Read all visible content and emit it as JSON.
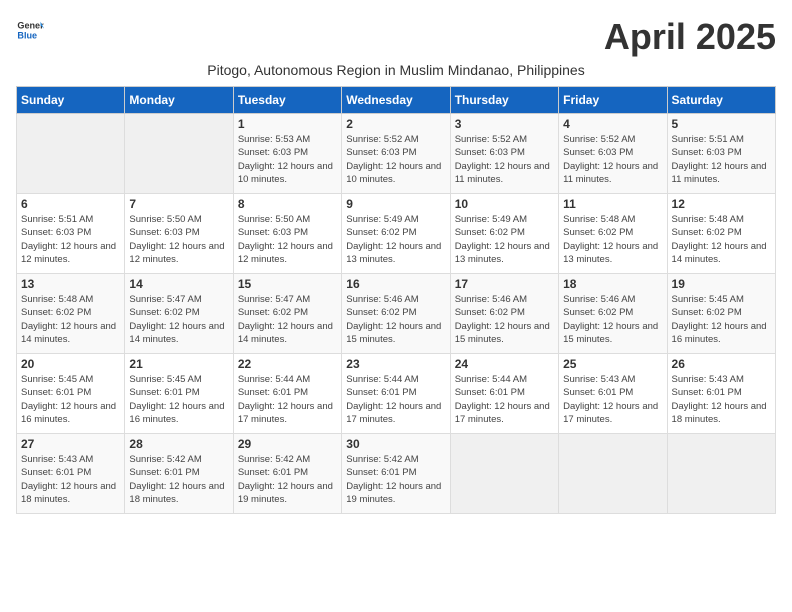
{
  "logo": {
    "general": "General",
    "blue": "Blue"
  },
  "title": "April 2025",
  "subtitle": "Pitogo, Autonomous Region in Muslim Mindanao, Philippines",
  "weekdays": [
    "Sunday",
    "Monday",
    "Tuesday",
    "Wednesday",
    "Thursday",
    "Friday",
    "Saturday"
  ],
  "weeks": [
    [
      {
        "day": "",
        "info": ""
      },
      {
        "day": "",
        "info": ""
      },
      {
        "day": "1",
        "info": "Sunrise: 5:53 AM\nSunset: 6:03 PM\nDaylight: 12 hours and 10 minutes."
      },
      {
        "day": "2",
        "info": "Sunrise: 5:52 AM\nSunset: 6:03 PM\nDaylight: 12 hours and 10 minutes."
      },
      {
        "day": "3",
        "info": "Sunrise: 5:52 AM\nSunset: 6:03 PM\nDaylight: 12 hours and 11 minutes."
      },
      {
        "day": "4",
        "info": "Sunrise: 5:52 AM\nSunset: 6:03 PM\nDaylight: 12 hours and 11 minutes."
      },
      {
        "day": "5",
        "info": "Sunrise: 5:51 AM\nSunset: 6:03 PM\nDaylight: 12 hours and 11 minutes."
      }
    ],
    [
      {
        "day": "6",
        "info": "Sunrise: 5:51 AM\nSunset: 6:03 PM\nDaylight: 12 hours and 12 minutes."
      },
      {
        "day": "7",
        "info": "Sunrise: 5:50 AM\nSunset: 6:03 PM\nDaylight: 12 hours and 12 minutes."
      },
      {
        "day": "8",
        "info": "Sunrise: 5:50 AM\nSunset: 6:03 PM\nDaylight: 12 hours and 12 minutes."
      },
      {
        "day": "9",
        "info": "Sunrise: 5:49 AM\nSunset: 6:02 PM\nDaylight: 12 hours and 13 minutes."
      },
      {
        "day": "10",
        "info": "Sunrise: 5:49 AM\nSunset: 6:02 PM\nDaylight: 12 hours and 13 minutes."
      },
      {
        "day": "11",
        "info": "Sunrise: 5:48 AM\nSunset: 6:02 PM\nDaylight: 12 hours and 13 minutes."
      },
      {
        "day": "12",
        "info": "Sunrise: 5:48 AM\nSunset: 6:02 PM\nDaylight: 12 hours and 14 minutes."
      }
    ],
    [
      {
        "day": "13",
        "info": "Sunrise: 5:48 AM\nSunset: 6:02 PM\nDaylight: 12 hours and 14 minutes."
      },
      {
        "day": "14",
        "info": "Sunrise: 5:47 AM\nSunset: 6:02 PM\nDaylight: 12 hours and 14 minutes."
      },
      {
        "day": "15",
        "info": "Sunrise: 5:47 AM\nSunset: 6:02 PM\nDaylight: 12 hours and 14 minutes."
      },
      {
        "day": "16",
        "info": "Sunrise: 5:46 AM\nSunset: 6:02 PM\nDaylight: 12 hours and 15 minutes."
      },
      {
        "day": "17",
        "info": "Sunrise: 5:46 AM\nSunset: 6:02 PM\nDaylight: 12 hours and 15 minutes."
      },
      {
        "day": "18",
        "info": "Sunrise: 5:46 AM\nSunset: 6:02 PM\nDaylight: 12 hours and 15 minutes."
      },
      {
        "day": "19",
        "info": "Sunrise: 5:45 AM\nSunset: 6:02 PM\nDaylight: 12 hours and 16 minutes."
      }
    ],
    [
      {
        "day": "20",
        "info": "Sunrise: 5:45 AM\nSunset: 6:01 PM\nDaylight: 12 hours and 16 minutes."
      },
      {
        "day": "21",
        "info": "Sunrise: 5:45 AM\nSunset: 6:01 PM\nDaylight: 12 hours and 16 minutes."
      },
      {
        "day": "22",
        "info": "Sunrise: 5:44 AM\nSunset: 6:01 PM\nDaylight: 12 hours and 17 minutes."
      },
      {
        "day": "23",
        "info": "Sunrise: 5:44 AM\nSunset: 6:01 PM\nDaylight: 12 hours and 17 minutes."
      },
      {
        "day": "24",
        "info": "Sunrise: 5:44 AM\nSunset: 6:01 PM\nDaylight: 12 hours and 17 minutes."
      },
      {
        "day": "25",
        "info": "Sunrise: 5:43 AM\nSunset: 6:01 PM\nDaylight: 12 hours and 17 minutes."
      },
      {
        "day": "26",
        "info": "Sunrise: 5:43 AM\nSunset: 6:01 PM\nDaylight: 12 hours and 18 minutes."
      }
    ],
    [
      {
        "day": "27",
        "info": "Sunrise: 5:43 AM\nSunset: 6:01 PM\nDaylight: 12 hours and 18 minutes."
      },
      {
        "day": "28",
        "info": "Sunrise: 5:42 AM\nSunset: 6:01 PM\nDaylight: 12 hours and 18 minutes."
      },
      {
        "day": "29",
        "info": "Sunrise: 5:42 AM\nSunset: 6:01 PM\nDaylight: 12 hours and 19 minutes."
      },
      {
        "day": "30",
        "info": "Sunrise: 5:42 AM\nSunset: 6:01 PM\nDaylight: 12 hours and 19 minutes."
      },
      {
        "day": "",
        "info": ""
      },
      {
        "day": "",
        "info": ""
      },
      {
        "day": "",
        "info": ""
      }
    ]
  ]
}
